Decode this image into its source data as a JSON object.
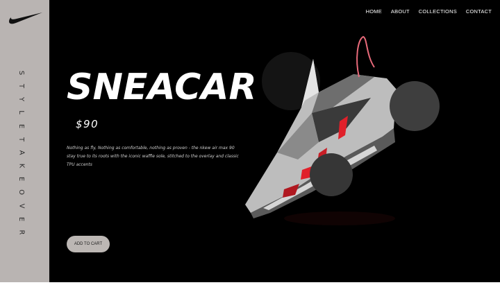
{
  "brand": {
    "logo_icon": "swoosh-logo-icon",
    "logo_color": "#111111"
  },
  "sidebar": {
    "background": "#b9b4b2",
    "tagline_words": [
      "STYLE",
      "TAKE",
      "OVER"
    ],
    "tagline_letters": [
      "S",
      "T",
      "Y",
      "L",
      "E",
      "T",
      "A",
      "K",
      "E",
      "O",
      "V",
      "E",
      "R"
    ]
  },
  "nav": {
    "items": [
      {
        "label": "HOME"
      },
      {
        "label": "ABOUT"
      },
      {
        "label": "COLLECTIONS"
      },
      {
        "label": "CONTACT"
      }
    ]
  },
  "hero": {
    "background": "#000000",
    "title": "SNEACAR",
    "price": "$90",
    "description": "Nothing as fly, Nothing as comfortable, nothing as proven - the nkew air max 90 stay true to its roots with the iconic waffle sole, stitched to the overlay and classic TPU accents",
    "cta_label": "ADD TO CART",
    "cta_color": "#bcb7b4",
    "product_image": "futuristic-sneaker-image",
    "accent_color": "#e0202a"
  }
}
